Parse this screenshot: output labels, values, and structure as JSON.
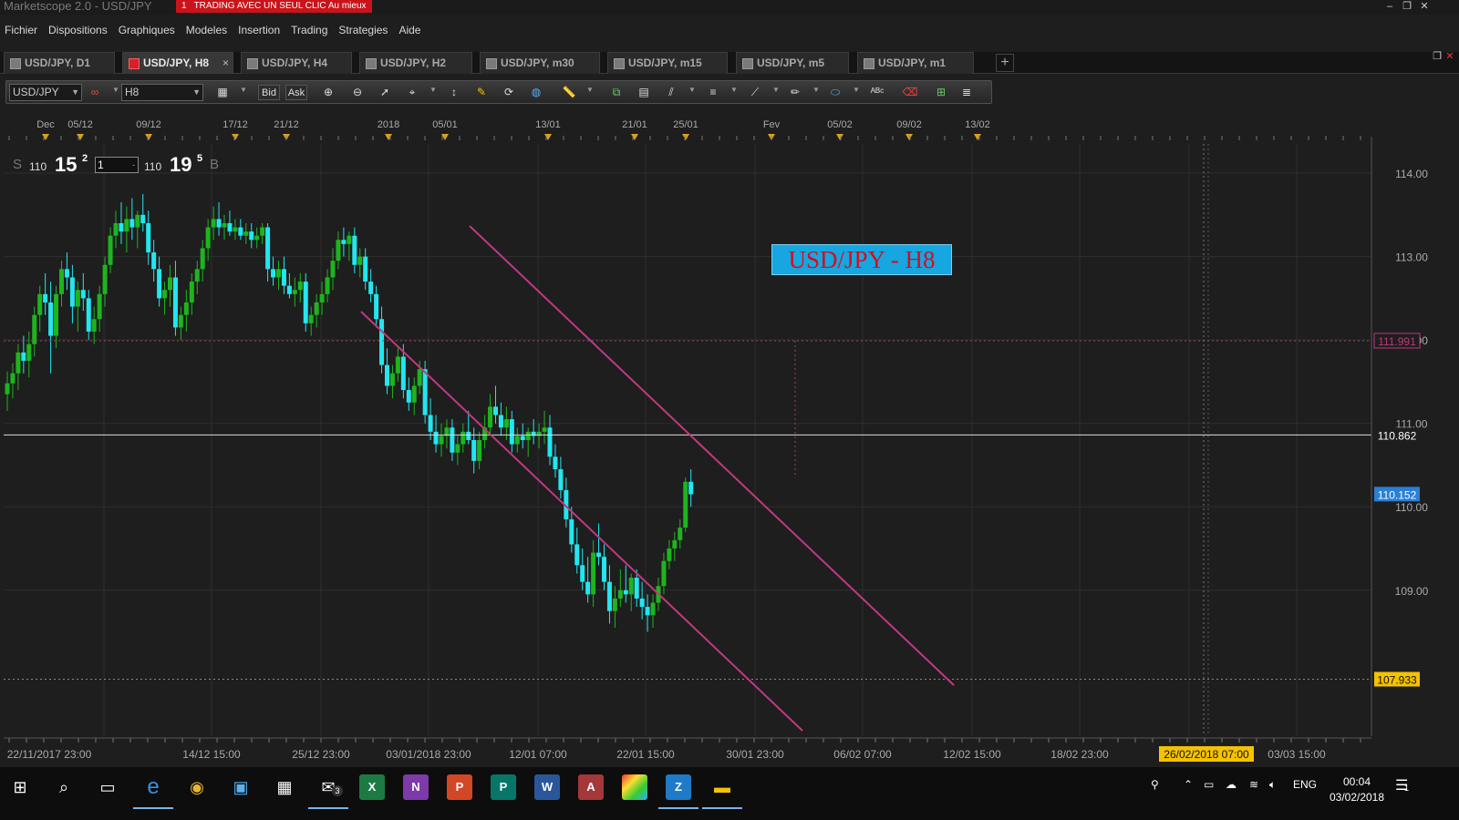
{
  "window": {
    "title": "Marketscope 2.0 - USD/JPY",
    "promo_index": "1",
    "promo_text": "TRADING AVEC UN SEUL CLIC Au mieux",
    "controls": {
      "minimize": "–",
      "restore": "❐",
      "close": "✕"
    }
  },
  "menu": [
    "Fichier",
    "Dispositions",
    "Graphiques",
    "Modeles",
    "Insertion",
    "Trading",
    "Strategies",
    "Aide"
  ],
  "tabs": [
    {
      "label": "USD/JPY, D1",
      "active": false
    },
    {
      "label": "USD/JPY, H8",
      "active": true,
      "close": "×"
    },
    {
      "label": "USD/JPY, H4",
      "active": false
    },
    {
      "label": "USD/JPY, H2",
      "active": false
    },
    {
      "label": "USD/JPY, m30",
      "active": false
    },
    {
      "label": "USD/JPY, m15",
      "active": false
    },
    {
      "label": "USD/JPY, m5",
      "active": false
    },
    {
      "label": "USD/JPY, m1",
      "active": false
    }
  ],
  "add_tab": "+",
  "toolbar": {
    "instrument": "USD/JPY",
    "timeframe": "H8",
    "bid_label": "Bid",
    "ask_label": "Ask"
  },
  "quote": {
    "sell_label": "S",
    "sell_big_figure": "110",
    "sell_pips": "15",
    "sell_fraction": "2",
    "quantity": "1",
    "buy_big_figure": "110",
    "buy_pips": "19",
    "buy_fraction": "5",
    "buy_label": "B"
  },
  "chart_label": "USD/JPY - H8",
  "chart_data": {
    "type": "candlestick",
    "instrument": "USD/JPY",
    "timeframe": "H8",
    "top_axis_labels": [
      "Dec",
      "05/12",
      "09/12",
      "17/12",
      "21/12",
      "2018",
      "05/01",
      "13/01",
      "21/01",
      "25/01",
      "Fev",
      "05/02",
      "09/02",
      "13/02"
    ],
    "bottom_axis_labels": [
      "22/11/2017 23:00",
      "14/12 15:00",
      "25/12 23:00",
      "03/01/2018 23:00",
      "12/01 07:00",
      "22/01 15:00",
      "30/01 23:00",
      "06/02 07:00",
      "12/02 15:00",
      "18/02 23:00",
      "26/02/2018 07:00",
      "03/03 15:00"
    ],
    "cursor_date_label": "26/02/2018 07:00",
    "y_ticks": [
      "114.00",
      "113.00",
      "112.00",
      "111.00",
      "110.00",
      "109.00"
    ],
    "ylim": [
      107.25,
      114.35
    ],
    "price_markers": [
      {
        "value": "111.991",
        "color": "#c0397f"
      },
      {
        "value": "110.862",
        "color": "#ffffff"
      },
      {
        "value": "110.152",
        "color": "#2a7fd6"
      },
      {
        "value": "107.933",
        "color": "#f5c200"
      }
    ],
    "up_color": "#1eb41e",
    "down_color": "#22e6f0",
    "channel_color": "#c0397f",
    "candles": [
      [
        111.35,
        111.62,
        111.15,
        111.48
      ],
      [
        111.48,
        111.72,
        111.3,
        111.6
      ],
      [
        111.6,
        111.95,
        111.4,
        111.85
      ],
      [
        111.85,
        112.05,
        111.6,
        111.75
      ],
      [
        111.75,
        112.1,
        111.55,
        111.95
      ],
      [
        111.95,
        112.4,
        111.8,
        112.3
      ],
      [
        112.3,
        112.65,
        112.1,
        112.55
      ],
      [
        112.55,
        112.8,
        112.3,
        112.45
      ],
      [
        112.45,
        112.7,
        111.6,
        112.05
      ],
      [
        112.05,
        112.65,
        111.9,
        112.55
      ],
      [
        112.55,
        112.95,
        112.4,
        112.85
      ],
      [
        112.85,
        113.05,
        112.6,
        112.75
      ],
      [
        112.75,
        112.9,
        112.2,
        112.4
      ],
      [
        112.4,
        112.7,
        112.1,
        112.6
      ],
      [
        112.6,
        112.8,
        112.35,
        112.5
      ],
      [
        112.5,
        112.6,
        112.0,
        112.1
      ],
      [
        112.1,
        112.4,
        111.95,
        112.25
      ],
      [
        112.25,
        112.65,
        112.1,
        112.55
      ],
      [
        112.55,
        113.0,
        112.4,
        112.9
      ],
      [
        112.9,
        113.35,
        112.8,
        113.25
      ],
      [
        113.25,
        113.55,
        113.1,
        113.4
      ],
      [
        113.4,
        113.65,
        113.15,
        113.3
      ],
      [
        113.3,
        113.6,
        113.05,
        113.45
      ],
      [
        113.45,
        113.7,
        113.2,
        113.35
      ],
      [
        113.35,
        113.55,
        113.1,
        113.5
      ],
      [
        113.5,
        113.75,
        113.3,
        113.4
      ],
      [
        113.4,
        113.55,
        112.9,
        113.05
      ],
      [
        113.05,
        113.2,
        112.7,
        112.85
      ],
      [
        112.85,
        113.0,
        112.4,
        112.5
      ],
      [
        112.5,
        112.7,
        112.3,
        112.6
      ],
      [
        112.6,
        112.9,
        112.4,
        112.75
      ],
      [
        112.75,
        112.95,
        112.05,
        112.15
      ],
      [
        112.15,
        112.4,
        112.0,
        112.3
      ],
      [
        112.3,
        112.6,
        112.1,
        112.45
      ],
      [
        112.45,
        112.8,
        112.3,
        112.7
      ],
      [
        112.7,
        112.95,
        112.55,
        112.85
      ],
      [
        112.85,
        113.2,
        112.7,
        113.1
      ],
      [
        113.1,
        113.45,
        112.95,
        113.35
      ],
      [
        113.35,
        113.6,
        113.2,
        113.45
      ],
      [
        113.45,
        113.65,
        113.25,
        113.35
      ],
      [
        113.35,
        113.5,
        113.2,
        113.4
      ],
      [
        113.4,
        113.55,
        113.25,
        113.3
      ],
      [
        113.3,
        113.45,
        113.2,
        113.35
      ],
      [
        113.35,
        113.45,
        113.2,
        113.25
      ],
      [
        113.25,
        113.4,
        113.15,
        113.3
      ],
      [
        113.3,
        113.4,
        113.1,
        113.2
      ],
      [
        113.2,
        113.35,
        113.1,
        113.25
      ],
      [
        113.25,
        113.4,
        113.15,
        113.35
      ],
      [
        113.35,
        113.4,
        112.7,
        112.85
      ],
      [
        112.85,
        113.0,
        112.65,
        112.75
      ],
      [
        112.75,
        112.95,
        112.6,
        112.85
      ],
      [
        112.85,
        113.0,
        112.55,
        112.65
      ],
      [
        112.65,
        112.8,
        112.5,
        112.55
      ],
      [
        112.55,
        112.75,
        112.4,
        112.6
      ],
      [
        112.6,
        112.8,
        112.45,
        112.7
      ],
      [
        112.7,
        112.8,
        112.1,
        112.2
      ],
      [
        112.2,
        112.4,
        112.05,
        112.3
      ],
      [
        112.3,
        112.55,
        112.15,
        112.45
      ],
      [
        112.45,
        112.7,
        112.3,
        112.55
      ],
      [
        112.55,
        112.85,
        112.45,
        112.75
      ],
      [
        112.75,
        113.1,
        112.6,
        112.95
      ],
      [
        112.95,
        113.3,
        112.85,
        113.2
      ],
      [
        113.2,
        113.35,
        113.0,
        113.15
      ],
      [
        113.15,
        113.3,
        112.95,
        113.25
      ],
      [
        113.25,
        113.35,
        112.8,
        112.9
      ],
      [
        112.9,
        113.1,
        112.75,
        113.0
      ],
      [
        113.0,
        113.1,
        112.6,
        112.7
      ],
      [
        112.7,
        112.85,
        112.45,
        112.55
      ],
      [
        112.55,
        112.65,
        112.15,
        112.25
      ],
      [
        112.25,
        112.4,
        111.6,
        111.7
      ],
      [
        111.7,
        111.9,
        111.35,
        111.45
      ],
      [
        111.45,
        111.7,
        111.3,
        111.6
      ],
      [
        111.6,
        111.9,
        111.5,
        111.8
      ],
      [
        111.8,
        111.95,
        111.3,
        111.4
      ],
      [
        111.4,
        111.55,
        111.15,
        111.25
      ],
      [
        111.25,
        111.55,
        111.1,
        111.45
      ],
      [
        111.45,
        111.75,
        111.35,
        111.65
      ],
      [
        111.65,
        111.75,
        111.0,
        111.1
      ],
      [
        111.1,
        111.3,
        110.8,
        110.9
      ],
      [
        110.9,
        111.1,
        110.65,
        110.75
      ],
      [
        110.75,
        111.0,
        110.6,
        110.85
      ],
      [
        110.85,
        111.05,
        110.7,
        110.95
      ],
      [
        110.95,
        111.05,
        110.55,
        110.65
      ],
      [
        110.65,
        110.85,
        110.5,
        110.75
      ],
      [
        110.75,
        111.0,
        110.65,
        110.9
      ],
      [
        110.9,
        111.15,
        110.75,
        110.8
      ],
      [
        110.8,
        110.95,
        110.4,
        110.55
      ],
      [
        110.55,
        110.9,
        110.45,
        110.8
      ],
      [
        110.8,
        111.1,
        110.7,
        110.95
      ],
      [
        110.95,
        111.35,
        110.85,
        111.2
      ],
      [
        111.2,
        111.45,
        111.0,
        111.1
      ],
      [
        111.1,
        111.25,
        110.85,
        110.95
      ],
      [
        110.95,
        111.2,
        110.8,
        111.05
      ],
      [
        111.05,
        111.15,
        110.65,
        110.75
      ],
      [
        110.75,
        110.95,
        110.65,
        110.85
      ],
      [
        110.85,
        111.0,
        110.7,
        110.8
      ],
      [
        110.8,
        110.95,
        110.6,
        110.9
      ],
      [
        110.9,
        111.05,
        110.75,
        110.85
      ],
      [
        110.85,
        111.0,
        110.7,
        110.9
      ],
      [
        110.9,
        111.15,
        110.75,
        110.95
      ],
      [
        110.95,
        111.1,
        110.5,
        110.6
      ],
      [
        110.6,
        110.75,
        110.35,
        110.45
      ],
      [
        110.45,
        110.6,
        110.1,
        110.2
      ],
      [
        110.2,
        110.35,
        109.75,
        109.85
      ],
      [
        109.85,
        110.0,
        109.45,
        109.55
      ],
      [
        109.55,
        109.75,
        109.2,
        109.3
      ],
      [
        109.3,
        109.5,
        109.0,
        109.1
      ],
      [
        109.1,
        109.4,
        108.85,
        108.95
      ],
      [
        108.95,
        109.6,
        108.8,
        109.45
      ],
      [
        109.45,
        109.8,
        109.3,
        109.4
      ],
      [
        109.4,
        109.55,
        109.0,
        109.1
      ],
      [
        109.1,
        109.3,
        108.6,
        108.75
      ],
      [
        108.75,
        109.05,
        108.55,
        108.9
      ],
      [
        108.9,
        109.25,
        108.8,
        109.0
      ],
      [
        109.0,
        109.3,
        108.85,
        108.95
      ],
      [
        108.95,
        109.2,
        108.75,
        109.15
      ],
      [
        109.15,
        109.25,
        108.8,
        108.9
      ],
      [
        108.9,
        109.1,
        108.65,
        108.8
      ],
      [
        108.8,
        108.95,
        108.5,
        108.7
      ],
      [
        108.7,
        108.95,
        108.55,
        108.85
      ],
      [
        108.85,
        109.15,
        108.75,
        109.05
      ],
      [
        109.05,
        109.45,
        108.95,
        109.35
      ],
      [
        109.35,
        109.6,
        109.25,
        109.5
      ],
      [
        109.5,
        109.7,
        109.35,
        109.6
      ],
      [
        109.6,
        109.85,
        109.5,
        109.75
      ],
      [
        109.75,
        110.35,
        109.7,
        110.3
      ],
      [
        110.3,
        110.45,
        110.0,
        110.15
      ]
    ]
  },
  "taskbar": {
    "icons": [
      "start-icon",
      "search-icon",
      "task-view-icon",
      "edge-icon",
      "chrome-icon",
      "terminal-icon",
      "calendar-icon",
      "mail-icon",
      "excel-icon",
      "onenote-icon",
      "powerpoint-icon",
      "publisher-icon",
      "word-icon",
      "access-icon",
      "color-app-icon",
      "app-icon",
      "file-explorer-icon"
    ],
    "mail_badge": "3",
    "language": "ENG",
    "time": "00:04",
    "date": "03/02/2018",
    "notification_badge": "1"
  }
}
